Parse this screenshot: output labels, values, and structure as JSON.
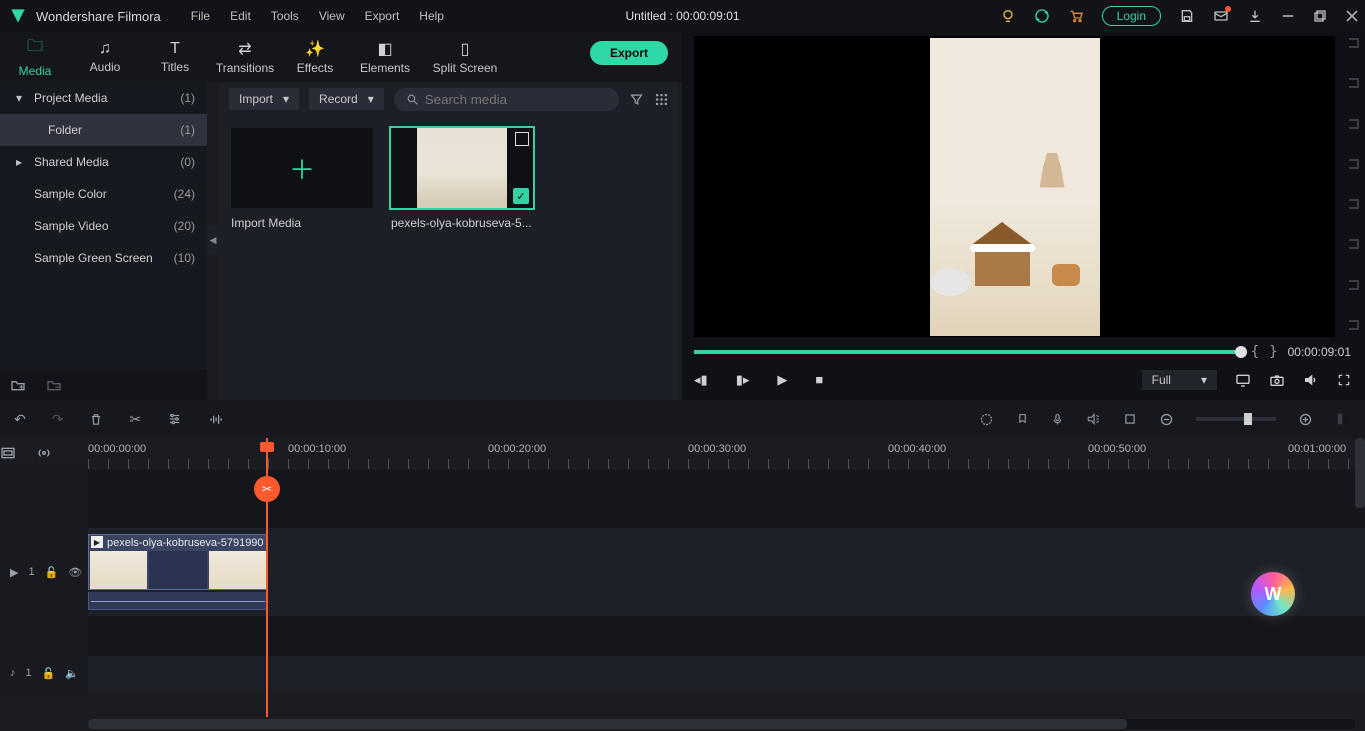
{
  "app_name": "Wondershare Filmora",
  "menus": [
    "File",
    "Edit",
    "Tools",
    "View",
    "Export",
    "Help"
  ],
  "document_title": "Untitled : 00:00:09:01",
  "login_label": "Login",
  "feature_tabs": [
    {
      "label": "Media",
      "active": true
    },
    {
      "label": "Audio"
    },
    {
      "label": "Titles"
    },
    {
      "label": "Transitions"
    },
    {
      "label": "Effects"
    },
    {
      "label": "Elements"
    },
    {
      "label": "Split Screen"
    }
  ],
  "export_button": "Export",
  "library_sidebar": [
    {
      "label": "Project Media",
      "count": "(1)",
      "arrow": "▾",
      "level": 0
    },
    {
      "label": "Folder",
      "count": "(1)",
      "level": 1,
      "active": true
    },
    {
      "label": "Shared Media",
      "count": "(0)",
      "arrow": "▸",
      "level": 0
    },
    {
      "label": "Sample Color",
      "count": "(24)",
      "level": 0
    },
    {
      "label": "Sample Video",
      "count": "(20)",
      "level": 0
    },
    {
      "label": "Sample Green Screen",
      "count": "(10)",
      "level": 0
    }
  ],
  "import_label": "Import",
  "record_label": "Record",
  "search_placeholder": "Search media",
  "thumbs": {
    "import_caption": "Import Media",
    "clip_caption": "pexels-olya-kobruseva-5...",
    "clip_full": "pexels-olya-kobruseva-5791990"
  },
  "scrub_time": "00:00:09:01",
  "quality_select": "Full",
  "ruler_marks": [
    {
      "pos": 0,
      "label": "00:00:00:00"
    },
    {
      "pos": 200,
      "label": "00:00:10:00"
    },
    {
      "pos": 400,
      "label": "00:00:20:00"
    },
    {
      "pos": 600,
      "label": "00:00:30:00"
    },
    {
      "pos": 800,
      "label": "00:00:40:00"
    },
    {
      "pos": 1000,
      "label": "00:00:50:00"
    },
    {
      "pos": 1200,
      "label": "00:01:00:00"
    }
  ],
  "tracks": {
    "video_label": "1",
    "audio_label": "1",
    "clip_label": "pexels-olya-kobruseva-5791990"
  }
}
